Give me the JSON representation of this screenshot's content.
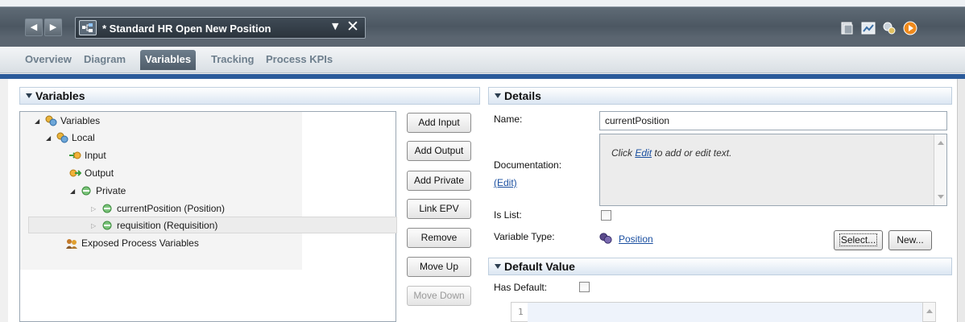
{
  "window": {
    "editor_tab_title": "* Standard HR Open New Position",
    "back_icon": "left-arrow-icon",
    "forward_icon": "right-arrow-icon",
    "close_icon": "close-icon",
    "toolbar_icons": [
      "dashboard-icon",
      "chart-icon",
      "debug-icon",
      "run-icon"
    ]
  },
  "subtabs": [
    {
      "label": "Overview",
      "active": false
    },
    {
      "label": "Diagram",
      "active": false
    },
    {
      "label": "Variables",
      "active": true
    },
    {
      "label": "Tracking",
      "active": false
    },
    {
      "label": "Process KPIs",
      "active": false
    }
  ],
  "variables_panel": {
    "title": "Variables",
    "tree": [
      {
        "label": "Variables",
        "icon": "variables-folder-icon"
      },
      {
        "label": "Local",
        "icon": "local-folder-icon"
      },
      {
        "label": "Input",
        "icon": "input-variable-icon"
      },
      {
        "label": "Output",
        "icon": "output-variable-icon"
      },
      {
        "label": "Private",
        "icon": "private-variable-icon"
      },
      {
        "label": "currentPosition (Position)",
        "icon": "private-variable-icon"
      },
      {
        "label": "requisition (Requisition)",
        "icon": "private-variable-icon",
        "selected": true
      },
      {
        "label": "Exposed Process Variables",
        "icon": "exposed-variables-icon"
      }
    ],
    "buttons": {
      "add_input": "Add Input",
      "add_output": "Add Output",
      "add_private": "Add Private",
      "link_epv": "Link EPV",
      "remove": "Remove",
      "move_up": "Move Up",
      "move_down": "Move Down"
    }
  },
  "details_panel": {
    "title": "Details",
    "name_label": "Name:",
    "name_value": "currentPosition",
    "documentation_label": "Documentation:",
    "documentation_edit": "(Edit)",
    "doc_text_before": "Click ",
    "doc_text_link": "Edit",
    "doc_text_after": " to add or edit text.",
    "is_list_label": "Is List:",
    "is_list_checked": false,
    "variable_type_label": "Variable Type:",
    "variable_type_value": "Position",
    "select_button": "Select...",
    "new_button": "New..."
  },
  "default_value_panel": {
    "title": "Default Value",
    "has_default_label": "Has Default:",
    "has_default_checked": false,
    "line_number": "1"
  },
  "colors": {
    "accent_blue": "#2b5b9a",
    "link": "#1a4fa0",
    "titlebar": "#4c5762"
  }
}
